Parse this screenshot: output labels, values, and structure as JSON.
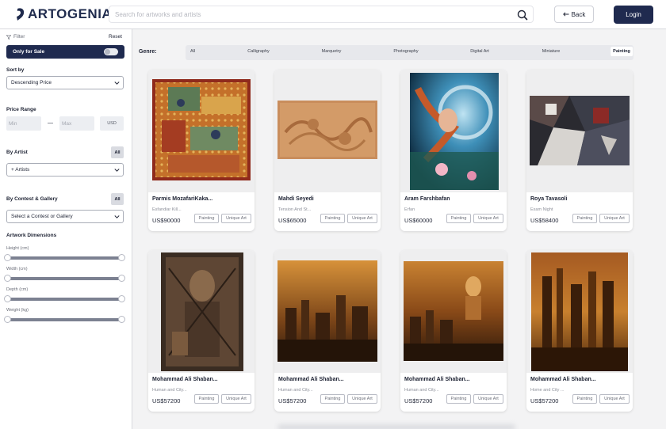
{
  "header": {
    "logo_text": "ARTOGENIA",
    "search_placeholder": "Search for artworks and artists",
    "back_label": "Back",
    "login_label": "Login"
  },
  "sidebar": {
    "filter_label": "Filter",
    "reset_label": "Reset",
    "only_for_sale_label": "Only for Sale",
    "sort_label": "Sort by",
    "sort_value": "Descending Price",
    "price_range_label": "Price Range",
    "min_placeholder": "Min",
    "max_placeholder": "Max",
    "currency_label": "USD",
    "artist_label": "By Artist",
    "artist_all_label": "All",
    "artist_select": "+ Artists",
    "contest_label": "By Contest & Gallery",
    "contest_all_label": "All",
    "contest_select": "Select a Contest or Gallery",
    "dimensions_label": "Artwork Dimensions",
    "dimensions": [
      {
        "label": "Height (cm)"
      },
      {
        "label": "Width (cm)"
      },
      {
        "label": "Depth (cm)"
      },
      {
        "label": "Weight (kg)"
      }
    ]
  },
  "genre": {
    "label": "Genre:",
    "tabs": [
      "All",
      "Calligraphy",
      "Marquetry",
      "Photography",
      "Digital Art",
      "Miniature",
      "Painting"
    ],
    "active": "Painting"
  },
  "cards": [
    {
      "artist": "Parmis MozafariKaka...",
      "title": "Esfandiar Kill...",
      "price": "US$90000",
      "tag1": "Painting",
      "tag2": "Unique Art"
    },
    {
      "artist": "Mahdi Seyedi",
      "title": "Tension And St...",
      "price": "US$65000",
      "tag1": "Painting",
      "tag2": "Unique Art"
    },
    {
      "artist": "Aram Farshbafan",
      "title": "Erfan",
      "price": "US$60000",
      "tag1": "Painting",
      "tag2": "Unique Art"
    },
    {
      "artist": "Roya Tavasoli",
      "title": "Exam Night",
      "price": "US$58400",
      "tag1": "Painting",
      "tag2": "Unique Art"
    },
    {
      "artist": "Mohammad Ali Shaban...",
      "title": "Human and City...",
      "price": "US$57200",
      "tag1": "Painting",
      "tag2": "Unique Art"
    },
    {
      "artist": "Mohammad Ali Shaban...",
      "title": "Human and City...",
      "price": "US$57200",
      "tag1": "Painting",
      "tag2": "Unique Art"
    },
    {
      "artist": "Mohammad Ali Shaban...",
      "title": "Human and City...",
      "price": "US$57200",
      "tag1": "Painting",
      "tag2": "Unique Art"
    },
    {
      "artist": "Mohammad Ali Shaban...",
      "title": "Home and City ...",
      "price": "US$57200",
      "tag1": "Painting",
      "tag2": "Unique Art"
    }
  ]
}
